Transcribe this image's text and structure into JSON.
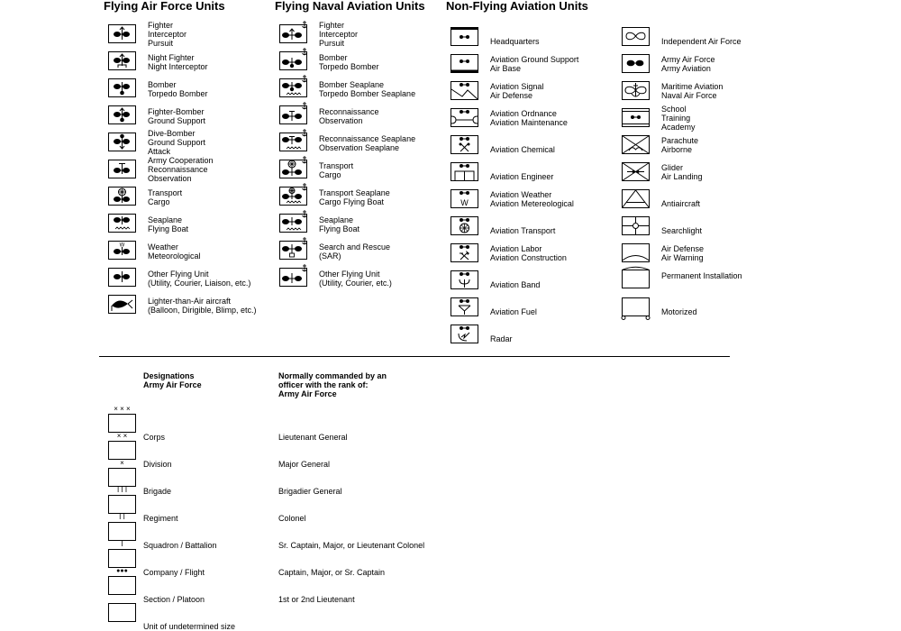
{
  "columns": [
    {
      "title": "Flying Air Force Units",
      "items": [
        {
          "icon": "fighter-icon",
          "lines": [
            "Fighter",
            "Interceptor",
            "Pursuit"
          ]
        },
        {
          "icon": "night-fighter-icon",
          "lines": [
            "Night Fighter",
            "Night Interceptor"
          ]
        },
        {
          "icon": "bomber-icon",
          "lines": [
            "Bomber",
            "Torpedo Bomber"
          ]
        },
        {
          "icon": "fighter-bomber-icon",
          "lines": [
            "Fighter-Bomber",
            "Ground Support"
          ]
        },
        {
          "icon": "dive-bomber-icon",
          "lines": [
            "Dive-Bomber",
            "Ground Support",
            "Attack"
          ]
        },
        {
          "icon": "army-cooperation-icon",
          "lines": [
            "Army Cooperation",
            "Reconnaissance",
            "Observation"
          ]
        },
        {
          "icon": "transport-icon",
          "lines": [
            "Transport",
            "Cargo"
          ]
        },
        {
          "icon": "seaplane-icon",
          "lines": [
            "Seaplane",
            "Flying Boat"
          ]
        },
        {
          "icon": "weather-icon",
          "lines": [
            "Weather",
            "Meteorological"
          ]
        },
        {
          "icon": "other-flying-unit-icon",
          "lines": [
            "Other Flying Unit",
            "(Utility, Courier, Liaison, etc.)"
          ]
        },
        {
          "icon": "lighter-than-air-icon",
          "lines": [
            "Lighter-than-Air aircraft",
            "(Balloon, Dirigible, Blimp, etc.)"
          ]
        }
      ]
    },
    {
      "title": "Flying Naval Aviation Units",
      "items": [
        {
          "icon": "naval-fighter-icon",
          "lines": [
            "Fighter",
            "Interceptor",
            "Pursuit"
          ]
        },
        {
          "icon": "naval-bomber-icon",
          "lines": [
            "Bomber",
            "Torpedo Bomber"
          ]
        },
        {
          "icon": "naval-bomber-seaplane-icon",
          "lines": [
            "Bomber Seaplane",
            "Torpedo Bomber Seaplane"
          ]
        },
        {
          "icon": "naval-reconnaissance-icon",
          "lines": [
            "Reconnaissance",
            "Observation"
          ]
        },
        {
          "icon": "naval-reconnaissance-seaplane-icon",
          "lines": [
            "Reconnaissance Seaplane",
            "Observation Seaplane"
          ]
        },
        {
          "icon": "naval-transport-icon",
          "lines": [
            "Transport",
            "Cargo"
          ]
        },
        {
          "icon": "naval-transport-seaplane-icon",
          "lines": [
            "Transport Seaplane",
            "Cargo Flying Boat"
          ]
        },
        {
          "icon": "naval-seaplane-icon",
          "lines": [
            "Seaplane",
            "Flying Boat"
          ]
        },
        {
          "icon": "search-and-rescue-icon",
          "lines": [
            "Search and Rescue",
            "(SAR)"
          ]
        },
        {
          "icon": "naval-other-flying-unit-icon",
          "lines": [
            "Other Flying Unit",
            "(Utility, Courier, etc.)"
          ]
        }
      ]
    },
    {
      "title": "Non-Flying Aviation Units",
      "items": [
        {
          "icon": "headquarters-icon",
          "lines": [
            "",
            "Headquarters"
          ]
        },
        {
          "icon": "ground-support-icon",
          "lines": [
            "Aviation Ground Support",
            "Air Base"
          ]
        },
        {
          "icon": "aviation-signal-icon",
          "lines": [
            "Aviation Signal",
            "Air Defense"
          ]
        },
        {
          "icon": "aviation-ordnance-icon",
          "lines": [
            "Aviation Ordnance",
            "Aviation Maintenance"
          ]
        },
        {
          "icon": "aviation-chemical-icon",
          "lines": [
            "",
            "Aviation Chemical"
          ]
        },
        {
          "icon": "aviation-engineer-icon",
          "lines": [
            "",
            "Aviation Engineer"
          ]
        },
        {
          "icon": "aviation-weather-icon",
          "lines": [
            "Aviation Weather",
            "Aviation Metereological"
          ]
        },
        {
          "icon": "aviation-transport-icon",
          "lines": [
            "",
            "Aviation Transport"
          ]
        },
        {
          "icon": "aviation-labor-icon",
          "lines": [
            "Aviation Labor",
            "Aviation Construction"
          ]
        },
        {
          "icon": "aviation-band-icon",
          "lines": [
            "",
            "Aviation Band"
          ]
        },
        {
          "icon": "aviation-fuel-icon",
          "lines": [
            "",
            "Aviation Fuel"
          ]
        },
        {
          "icon": "radar-icon",
          "lines": [
            "",
            "Radar"
          ]
        }
      ]
    },
    {
      "title": "",
      "items": [
        {
          "icon": "independent-air-force-icon",
          "lines": [
            "",
            "Independent Air Force"
          ]
        },
        {
          "icon": "army-air-force-icon",
          "lines": [
            "Army Air Force",
            "Army Aviation"
          ]
        },
        {
          "icon": "maritime-aviation-icon",
          "lines": [
            "Maritime Aviation",
            "Naval Air Force"
          ]
        },
        {
          "icon": "school-icon",
          "lines": [
            "School",
            "Training",
            "Academy"
          ]
        },
        {
          "icon": "parachute-icon",
          "lines": [
            "Parachute",
            "Airborne"
          ]
        },
        {
          "icon": "glider-icon",
          "lines": [
            "Glider",
            "Air Landing"
          ]
        },
        {
          "icon": "antiaircraft-icon",
          "lines": [
            "",
            "Antiaircraft"
          ]
        },
        {
          "icon": "searchlight-icon",
          "lines": [
            "",
            "Searchlight"
          ]
        },
        {
          "icon": "air-defense-icon",
          "lines": [
            "Air Defense",
            "Air Warning"
          ]
        },
        {
          "icon": "permanent-installation-icon",
          "lines": [
            "Permanent Installation"
          ]
        },
        {
          "icon": "motorized-icon",
          "lines": [
            "",
            "Motorized"
          ]
        }
      ]
    }
  ],
  "designations": {
    "header_left": [
      "Designations",
      "Army Air Force"
    ],
    "header_right": [
      "Normally commanded by an",
      "officer with the rank of:",
      "Army Air Force"
    ],
    "rows": [
      {
        "echelon": "× × ×",
        "name": "Corps",
        "rank": "Lieutenant General"
      },
      {
        "echelon": "× ×",
        "name": "Division",
        "rank": "Major General"
      },
      {
        "echelon": "×",
        "name": "Brigade",
        "rank": "Brigadier General"
      },
      {
        "echelon": "I I I",
        "name": "Regiment",
        "rank": "Colonel"
      },
      {
        "echelon": "I I",
        "name": "Squadron / Battalion",
        "rank": "Sr. Captain, Major, or Lieutenant Colonel"
      },
      {
        "echelon": "I",
        "name": "Company / Flight",
        "rank": "Captain, Major, or Sr. Captain"
      },
      {
        "echelon": "●●●",
        "name": "Section / Platoon",
        "rank": "1st or 2nd Lieutenant"
      },
      {
        "echelon": "",
        "name": "Unit of undetermined size",
        "rank": ""
      }
    ]
  }
}
